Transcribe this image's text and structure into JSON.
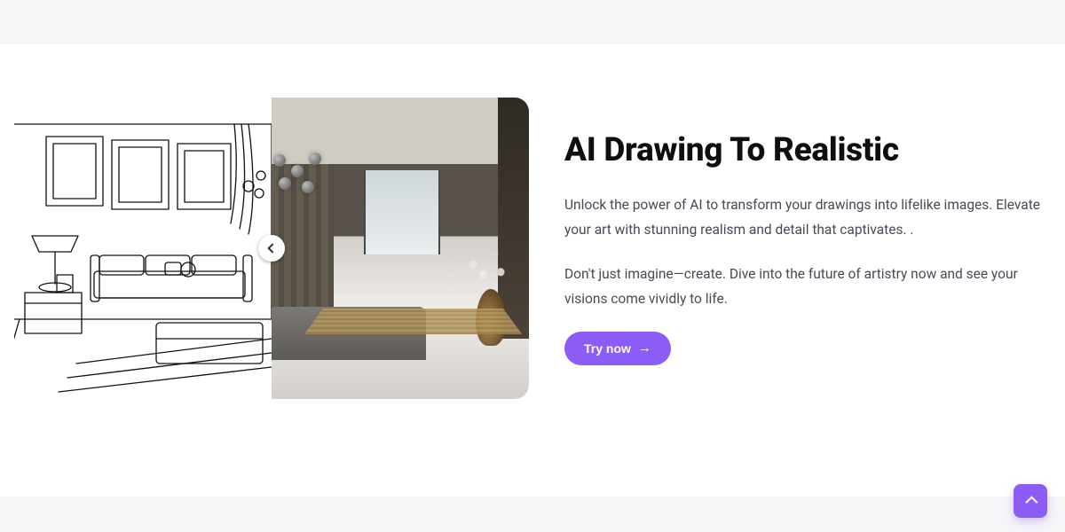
{
  "hero": {
    "title": "AI Drawing To Realistic",
    "paragraph1": "Unlock the power of AI to transform your drawings into lifelike images. Elevate your art with stunning realism and detail that captivates. .",
    "paragraph2": "Don't just imagine—create. Dive into the future of artistry now and see your visions come vividly to life.",
    "cta_label": "Try now",
    "cta_arrow": "→"
  },
  "slider": {
    "left_semantic": "sketch-interior",
    "right_semantic": "realistic-interior"
  },
  "colors": {
    "accent": "#8b5cf6",
    "muted_bg": "#f5f6f8"
  }
}
